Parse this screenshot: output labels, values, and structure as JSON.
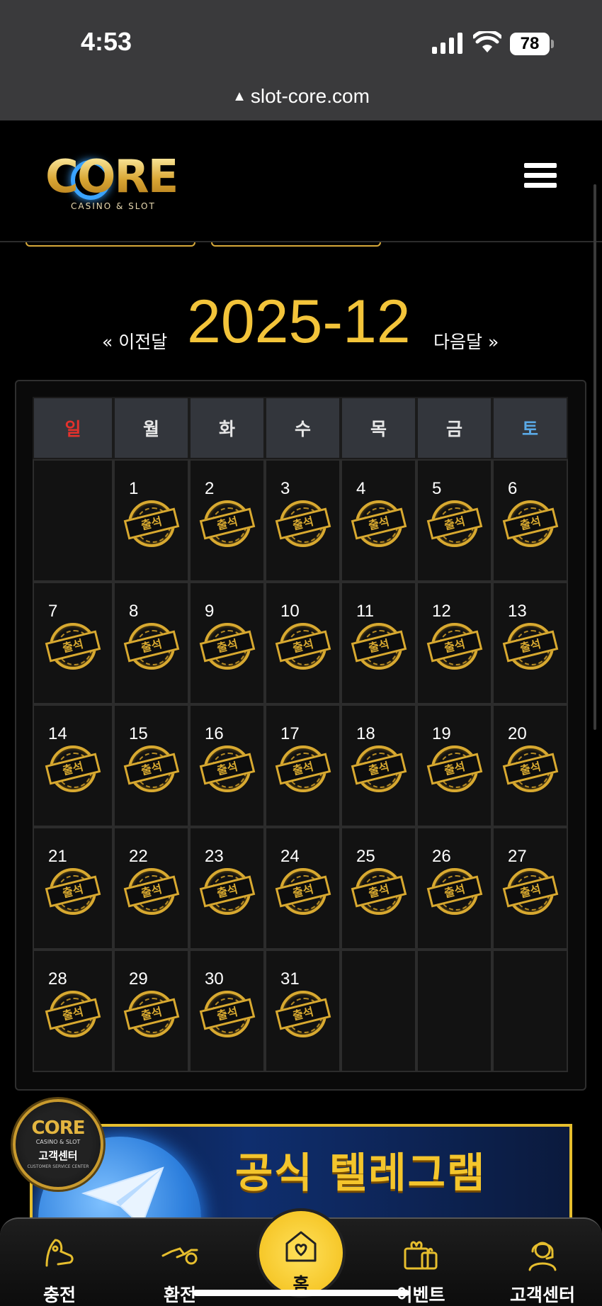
{
  "status_bar": {
    "time": "4:53",
    "battery": "78",
    "url": "slot-core.com"
  },
  "header": {
    "logo_text": "CORE",
    "logo_sub": "CASINO & SLOT",
    "menu_icon": "hamburger-menu-icon"
  },
  "calendar": {
    "prev_label": "« 이전달",
    "title": "2025-12",
    "next_label": "다음달 »",
    "weekdays": [
      "일",
      "월",
      "화",
      "수",
      "목",
      "금",
      "토"
    ],
    "weekday_colors": {
      "sun": "#e5312c",
      "sat": "#5aa9e6",
      "default": "#e6e6e6"
    },
    "stamp_label": "출석",
    "rows": [
      [
        "",
        "1",
        "2",
        "3",
        "4",
        "5",
        "6"
      ],
      [
        "7",
        "8",
        "9",
        "10",
        "11",
        "12",
        "13"
      ],
      [
        "14",
        "15",
        "16",
        "17",
        "18",
        "19",
        "20"
      ],
      [
        "21",
        "22",
        "23",
        "24",
        "25",
        "26",
        "27"
      ],
      [
        "28",
        "29",
        "30",
        "31",
        "",
        "",
        ""
      ]
    ]
  },
  "cs_badge": {
    "logo": "CORE",
    "sub": "CASINO & SLOT",
    "label": "고객센터",
    "sub2": "CUSTOMER SERVICE CENTER"
  },
  "banner": {
    "text": "공식 텔레그램",
    "icon": "telegram-icon"
  },
  "bottom_nav": {
    "items": [
      {
        "label": "충전",
        "icon": "deposit-icon"
      },
      {
        "label": "환전",
        "icon": "withdraw-icon"
      },
      {
        "label": "홈",
        "icon": "home-heart-icon"
      },
      {
        "label": "이벤트",
        "icon": "gift-icon"
      },
      {
        "label": "고객센터",
        "icon": "support-agent-icon"
      }
    ]
  },
  "colors": {
    "accent": "#f3c43a",
    "stamp": "#d8a930",
    "background": "#000000"
  }
}
